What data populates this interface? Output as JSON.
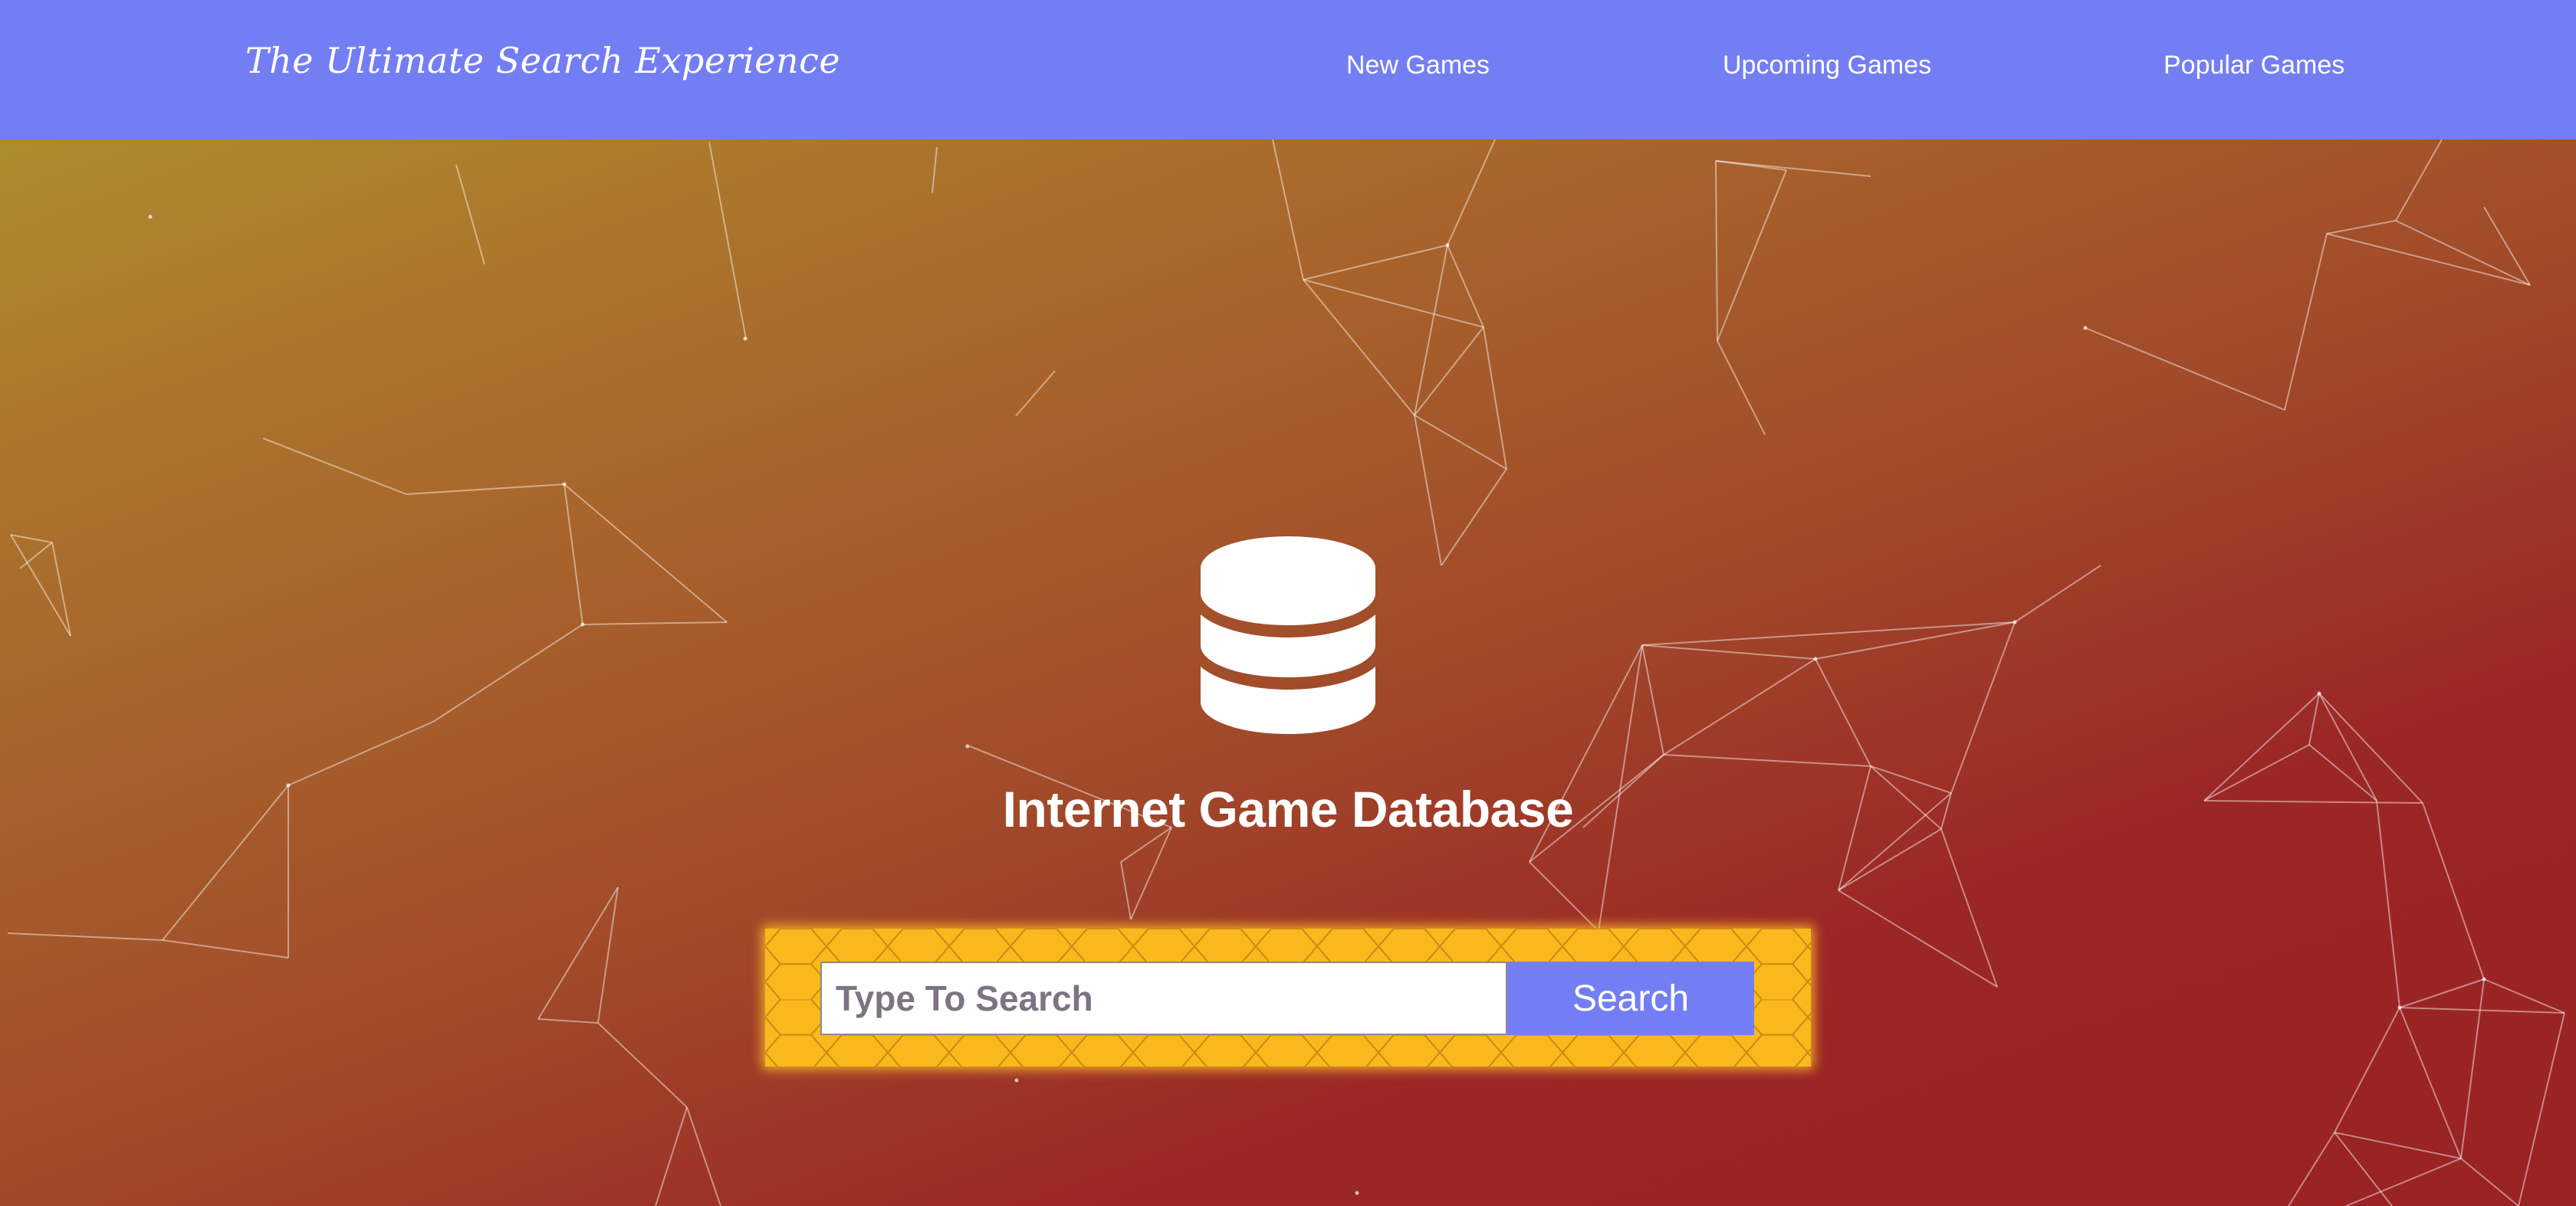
{
  "navbar": {
    "brand": "The Ultimate Search Experience",
    "links": [
      {
        "label": "New Games"
      },
      {
        "label": "Upcoming Games"
      },
      {
        "label": "Popular Games"
      }
    ]
  },
  "hero": {
    "icon": "database-icon",
    "title": "Internet Game Database"
  },
  "search": {
    "placeholder": "Type To Search",
    "value": "",
    "button_label": "Search"
  },
  "colors": {
    "navbar": "#747ef4",
    "accent": "#747ef4",
    "search_panel": "#f9b81c",
    "gradient_start": "#ae942c",
    "gradient_end": "#9a2222",
    "text_light": "#ffffff"
  }
}
